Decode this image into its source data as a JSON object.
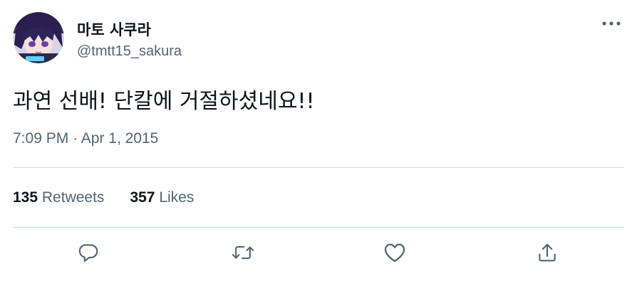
{
  "user": {
    "display_name": "마토 사쿠라",
    "handle": "@tmtt15_sakura"
  },
  "tweet": {
    "text": "과연 선배! 단칼에 거절하셨네요!!",
    "time": "7:09 PM",
    "separator": "·",
    "date": "Apr 1, 2015"
  },
  "stats": {
    "retweets_count": "135",
    "retweets_label": "Retweets",
    "likes_count": "357",
    "likes_label": "Likes"
  },
  "actions": [
    "reply-icon",
    "retweet-icon",
    "like-icon",
    "share-icon"
  ],
  "colors": {
    "text_primary": "#0f1419",
    "text_secondary": "#536471",
    "divider": "#cfd9de"
  }
}
